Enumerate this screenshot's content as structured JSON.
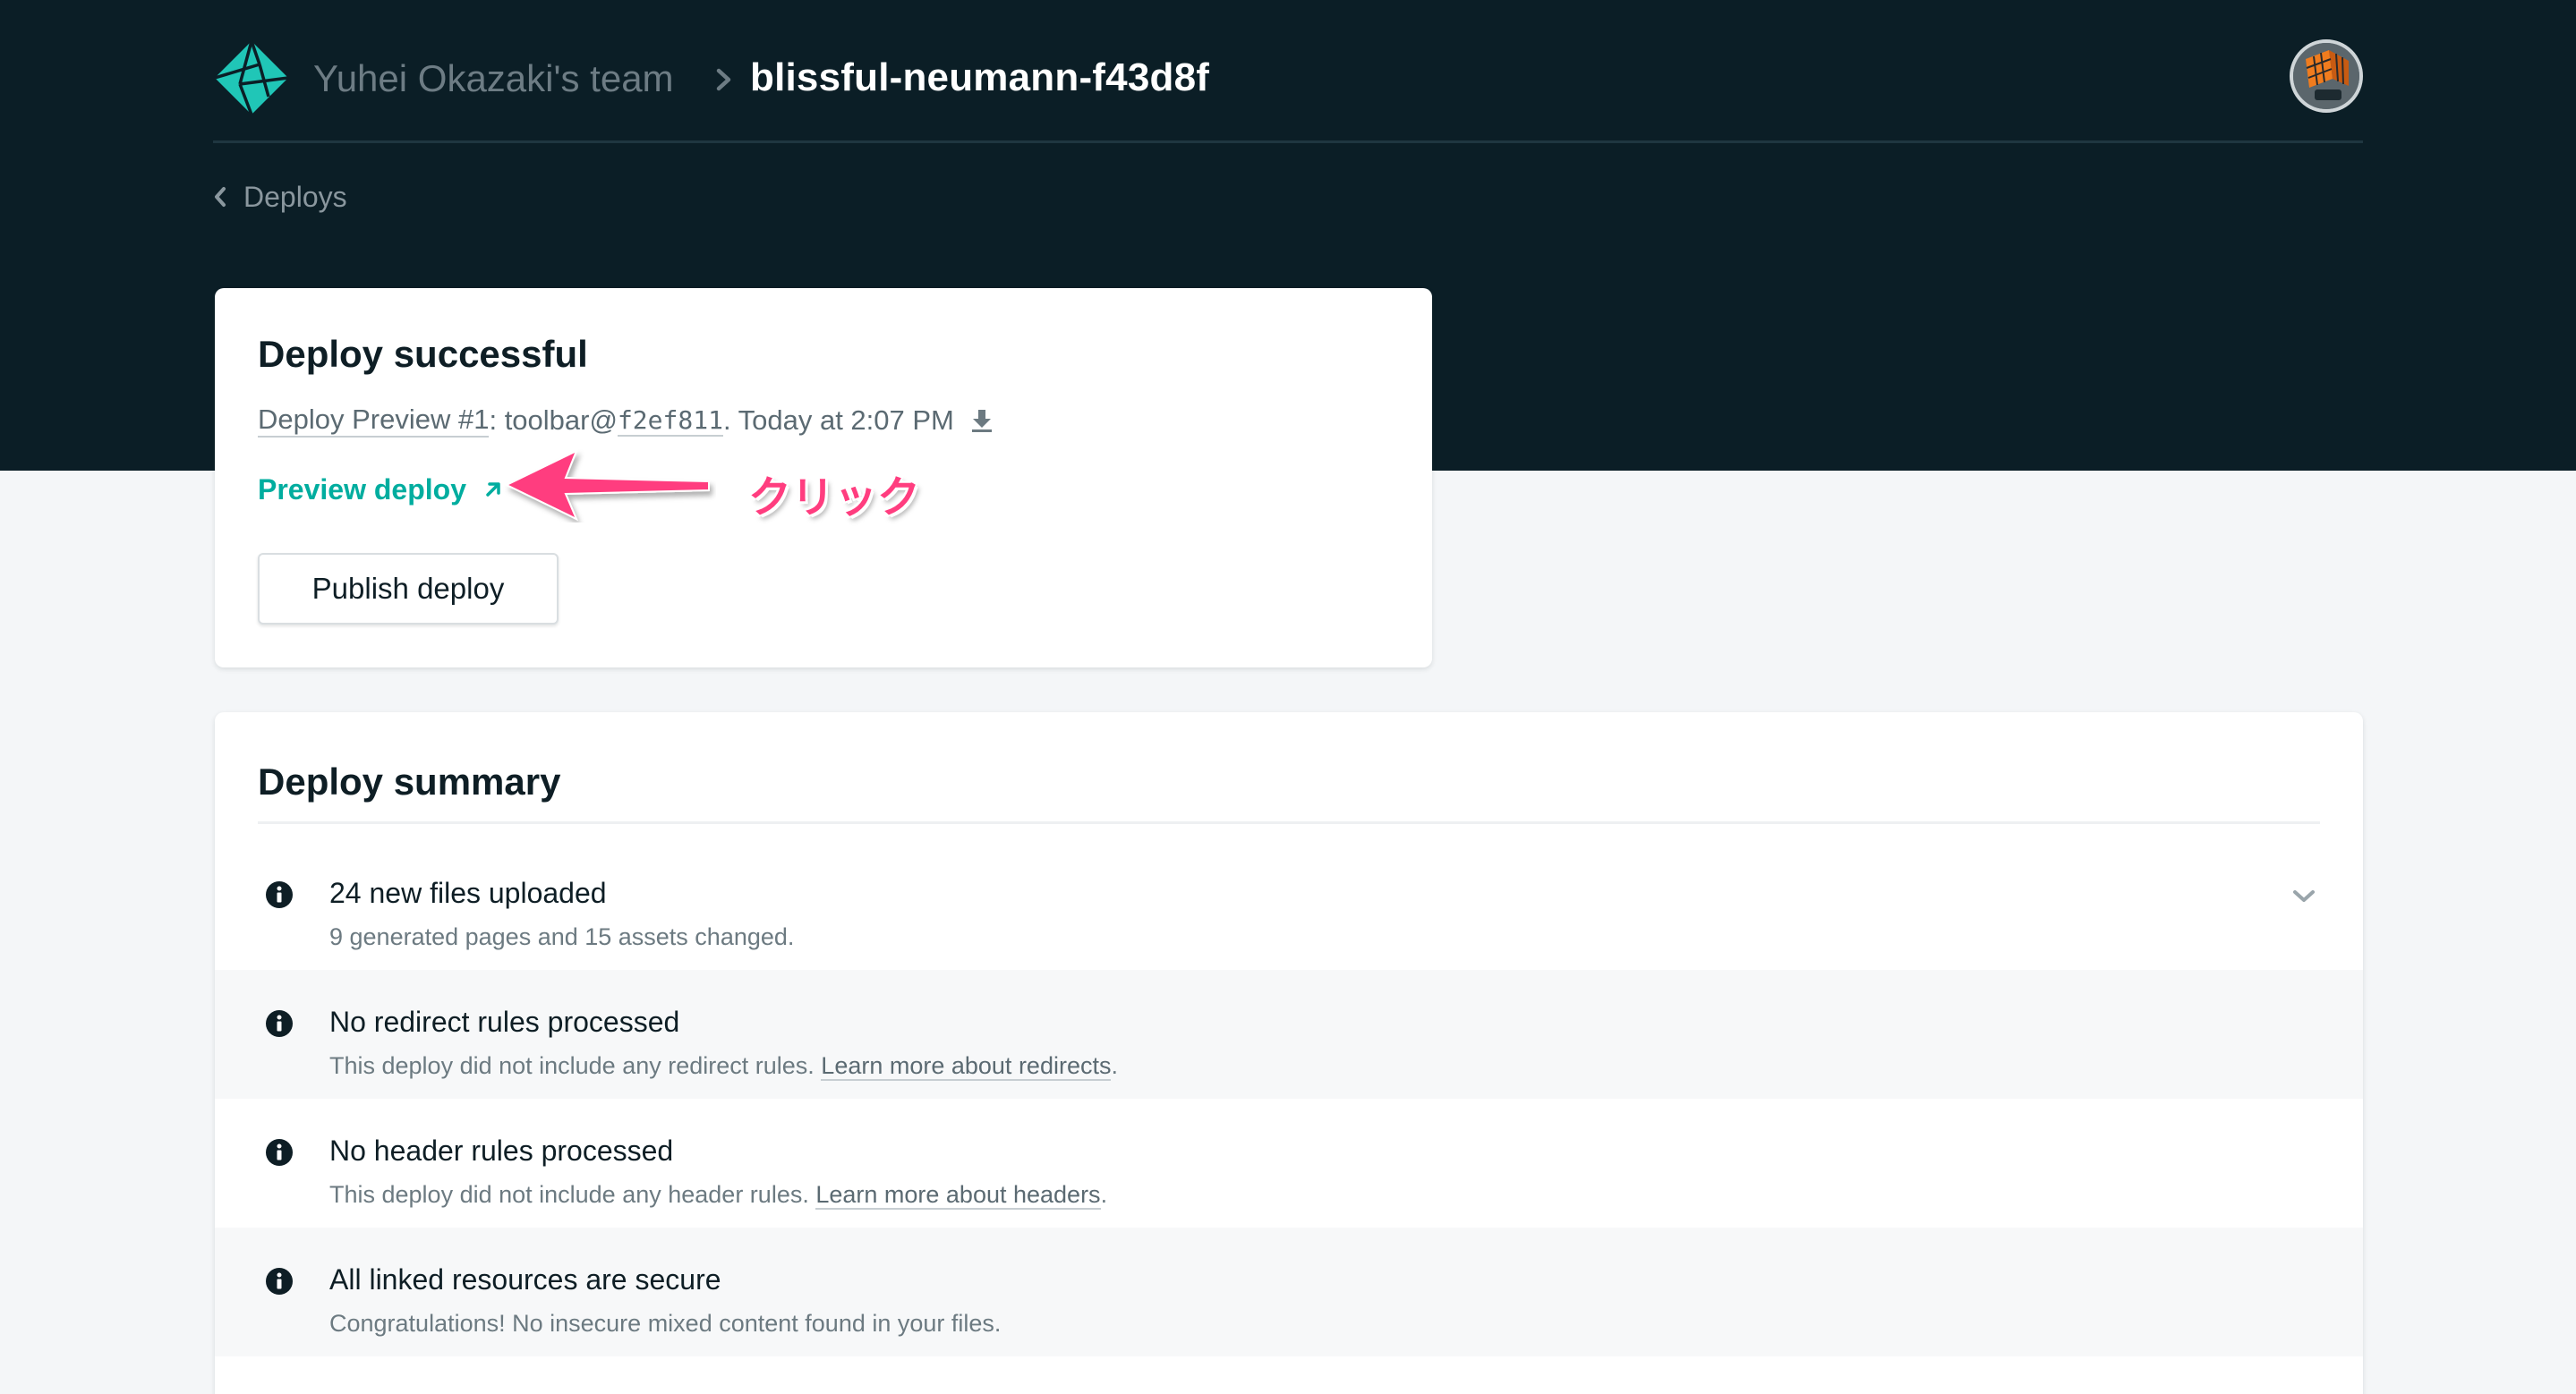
{
  "header": {
    "team_name": "Yuhei Okazaki's team",
    "site_name": "blissful-neumann-f43d8f",
    "logo_icon": "netlify-logo-icon",
    "avatar": "user-avatar"
  },
  "back_link": {
    "label": "Deploys",
    "icon": "chevron-left-icon"
  },
  "deploy_card": {
    "title": "Deploy successful",
    "preview_label": "Deploy Preview #1",
    "branch_text": ": toolbar@",
    "commit": "f2ef811",
    "time_text": ". Today at 2:07 PM",
    "download_icon": "download-icon",
    "preview_link": "Preview deploy",
    "publish_button": "Publish deploy"
  },
  "annotation": {
    "text": "クリック",
    "color": "#ff3d7f"
  },
  "summary": {
    "title": "Deploy summary",
    "rows": [
      {
        "head": "24 new files uploaded",
        "sub": "9 generated pages and 15 assets changed.",
        "link": "",
        "after": ""
      },
      {
        "head": "No redirect rules processed",
        "sub": "This deploy did not include any redirect rules. ",
        "link": "Learn more about redirects",
        "after": "."
      },
      {
        "head": "No header rules processed",
        "sub": "This deploy did not include any header rules. ",
        "link": "Learn more about headers",
        "after": "."
      },
      {
        "head": "All linked resources are secure",
        "sub": "Congratulations! No insecure mixed content found in your files.",
        "link": "",
        "after": ""
      }
    ]
  },
  "colors": {
    "header_bg": "#0b1e26",
    "accent_teal": "#00ad9f",
    "page_bg": "#f4f6f8"
  }
}
